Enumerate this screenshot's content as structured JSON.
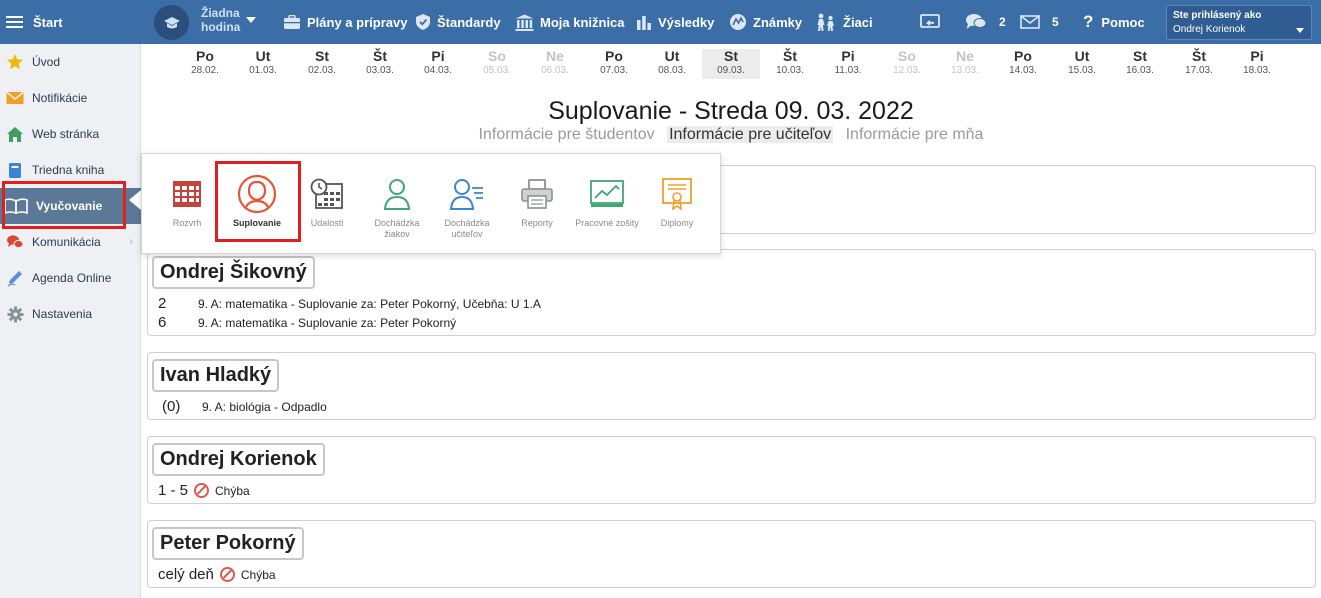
{
  "topbar": {
    "menu_label": "Štart",
    "hour_label_line1": "Žiadna",
    "hour_label_line2": "hodina",
    "items": [
      {
        "label": "Plány a prípravy",
        "icon": "briefcase-icon"
      },
      {
        "label": "Štandardy",
        "icon": "shield-icon"
      },
      {
        "label": "Moja knižnica",
        "icon": "library-icon"
      },
      {
        "label": "Výsledky",
        "icon": "bar-chart-icon"
      },
      {
        "label": "Známky",
        "icon": "grades-icon"
      },
      {
        "label": "Žiaci",
        "icon": "students-icon"
      }
    ],
    "messages_count": "2",
    "mail_count": "5",
    "help_label": "Pomoc",
    "login_line1": "Ste prihlásený ako",
    "login_line2": "Ondrej Korienok"
  },
  "sidebar": {
    "items": [
      {
        "label": "Úvod",
        "icon": "star-icon"
      },
      {
        "label": "Notifikácie",
        "icon": "envelope-icon"
      },
      {
        "label": "Web stránka",
        "icon": "home-icon"
      },
      {
        "label": "Triedna kniha",
        "icon": "class-book-icon"
      },
      {
        "label": "Vyučovanie",
        "icon": "open-book-icon"
      },
      {
        "label": "Komunikácia",
        "icon": "chat-icon"
      },
      {
        "label": "Agenda Online",
        "icon": "pen-icon"
      },
      {
        "label": "Nastavenia",
        "icon": "gear-icon"
      }
    ]
  },
  "days": [
    {
      "name": "Po",
      "date": "28.02."
    },
    {
      "name": "Ut",
      "date": "01.03."
    },
    {
      "name": "St",
      "date": "02.03."
    },
    {
      "name": "Št",
      "date": "03.03."
    },
    {
      "name": "Pi",
      "date": "04.03."
    },
    {
      "name": "So",
      "date": "05.03.",
      "weekend": true
    },
    {
      "name": "Ne",
      "date": "06.03.",
      "weekend": true
    },
    {
      "name": "Po",
      "date": "07.03."
    },
    {
      "name": "Ut",
      "date": "08.03."
    },
    {
      "name": "St",
      "date": "09.03.",
      "selected": true
    },
    {
      "name": "Št",
      "date": "10.03."
    },
    {
      "name": "Pi",
      "date": "11.03."
    },
    {
      "name": "So",
      "date": "12.03.",
      "weekend": true
    },
    {
      "name": "Ne",
      "date": "13.03.",
      "weekend": true
    },
    {
      "name": "Po",
      "date": "14.03."
    },
    {
      "name": "Ut",
      "date": "15.03."
    },
    {
      "name": "St",
      "date": "16.03."
    },
    {
      "name": "Št",
      "date": "17.03."
    },
    {
      "name": "Pi",
      "date": "18.03."
    }
  ],
  "main": {
    "title": "Suplovanie - Streda 09. 03. 2022",
    "tab_students": "Informácie pre študentov",
    "tab_teachers": "Informácie pre učiteľov",
    "tab_me": "Informácie pre mňa"
  },
  "popup": {
    "items": [
      {
        "label": "Rozvrh"
      },
      {
        "label": "Suplovanie"
      },
      {
        "label": "Udalosti"
      },
      {
        "label": "Dochádzka žiakov"
      },
      {
        "label": "Dochádzka učiteľov"
      },
      {
        "label": "Reporty"
      },
      {
        "label": "Pracovné zošity"
      },
      {
        "label": "Diplomy"
      }
    ]
  },
  "cards": [
    {
      "name": "Ondrej Šikovný",
      "rows": [
        {
          "num": "2",
          "text": "9. A: matematika - Suplovanie za: Peter Pokorný, Učebňa: U 1.A"
        },
        {
          "num": "6",
          "text": "9. A: matematika - Suplovanie za: Peter Pokorný"
        }
      ]
    },
    {
      "name": "Ivan Hladký",
      "rows": [
        {
          "num": "(0)",
          "text": "9. A: biológia - Odpadlo"
        }
      ]
    },
    {
      "name": "Ondrej Korienok",
      "range": "1 - 5",
      "error": "Chýba"
    },
    {
      "name": "Peter Pokorný",
      "range": "celý deň",
      "error": "Chýba"
    }
  ]
}
